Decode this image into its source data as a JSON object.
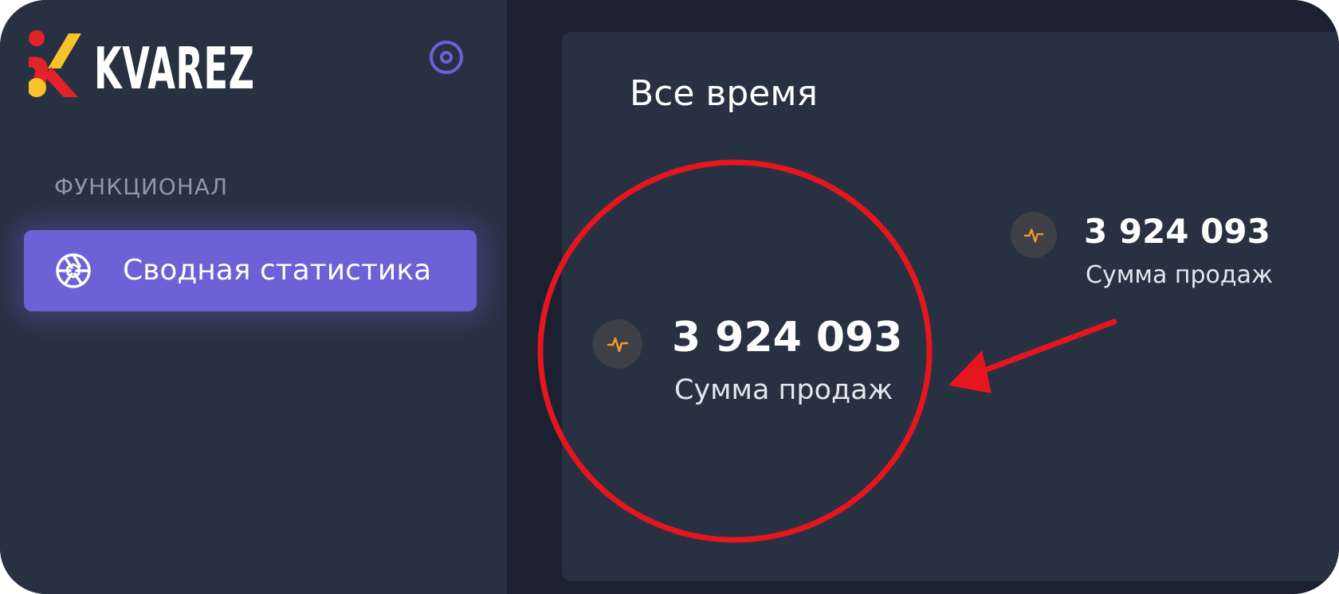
{
  "brand": {
    "name": "KVAREZ",
    "colors": {
      "red": "#e2232a",
      "yellow": "#f6c32a"
    }
  },
  "sidebar": {
    "section_label": "ФУНКЦИОНАЛ",
    "items": [
      {
        "label": "Сводная статистика",
        "icon": "aperture-icon",
        "active": true
      }
    ],
    "collapse_icon": "target-circle-icon",
    "accent_color": "#6b62d6"
  },
  "main": {
    "title": "Все время",
    "stats": [
      {
        "value": "3 924 093",
        "label": "Сумма продаж",
        "icon": "activity-pulse-icon",
        "highlighted": true
      },
      {
        "value": "3 924 093",
        "label": "Сумма продаж",
        "icon": "activity-pulse-icon",
        "highlighted": false
      }
    ]
  },
  "annotation": {
    "circle_color": "#e5161d",
    "arrow_color": "#e5161d"
  }
}
